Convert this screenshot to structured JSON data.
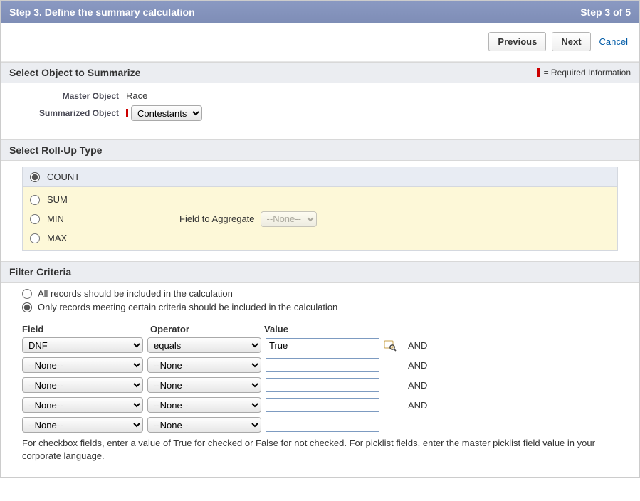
{
  "header": {
    "title": "Step 3. Define the summary calculation",
    "step_indicator": "Step 3 of 5"
  },
  "toolbar": {
    "previous": "Previous",
    "next": "Next",
    "cancel": "Cancel"
  },
  "sections": {
    "summarize": {
      "title": "Select Object to Summarize",
      "required_info": "= Required Information",
      "master_label": "Master Object",
      "master_value": "Race",
      "summarized_label": "Summarized Object",
      "summarized_value": "Contestants"
    },
    "rollup": {
      "title": "Select Roll-Up Type",
      "options": {
        "count": "COUNT",
        "sum": "SUM",
        "min": "MIN",
        "max": "MAX"
      },
      "field_to_aggregate_label": "Field to Aggregate",
      "field_to_aggregate_value": "--None--"
    },
    "filter": {
      "title": "Filter Criteria",
      "opt_all": "All records should be included in the calculation",
      "opt_criteria": "Only records meeting certain criteria should be included in the calculation",
      "headers": {
        "field": "Field",
        "operator": "Operator",
        "value": "Value"
      },
      "rows": [
        {
          "field": "DNF",
          "operator": "equals",
          "value": "True",
          "conj": "AND",
          "lookup": true
        },
        {
          "field": "--None--",
          "operator": "--None--",
          "value": "",
          "conj": "AND",
          "lookup": false
        },
        {
          "field": "--None--",
          "operator": "--None--",
          "value": "",
          "conj": "AND",
          "lookup": false
        },
        {
          "field": "--None--",
          "operator": "--None--",
          "value": "",
          "conj": "AND",
          "lookup": false
        },
        {
          "field": "--None--",
          "operator": "--None--",
          "value": "",
          "conj": "",
          "lookup": false
        }
      ],
      "hint": "For checkbox fields, enter a value of True for checked or False for not checked. For picklist fields, enter the master picklist field value in your corporate language."
    }
  }
}
